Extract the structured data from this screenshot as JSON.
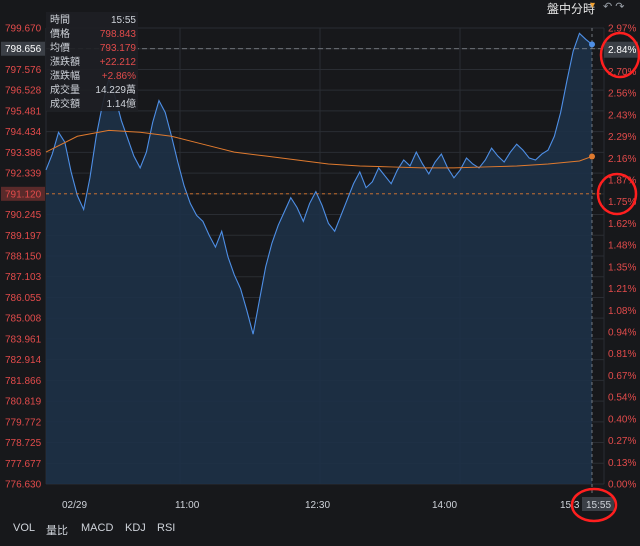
{
  "header": {
    "title": "盤中分時"
  },
  "info_box": {
    "rows": [
      {
        "label": "時間",
        "value": "15:55"
      },
      {
        "label": "價格",
        "value": "798.843"
      },
      {
        "label": "均價",
        "value": "793.179"
      },
      {
        "label": "漲跌額",
        "value": "+22.212"
      },
      {
        "label": "漲跌幅",
        "value": "+2.86%"
      },
      {
        "label": "成交量",
        "value": "14.229萬"
      },
      {
        "label": "成交額",
        "value": "1.14億"
      }
    ]
  },
  "bottom_tabs": [
    "VOL",
    "量比",
    "MACD",
    "KDJ",
    "RSI"
  ],
  "chart_data": {
    "type": "line",
    "y_ticks_left": [
      "799.670",
      "798.656",
      "797.576",
      "796.528",
      "795.481",
      "794.434",
      "793.386",
      "792.339",
      "791.120",
      "790.245",
      "789.197",
      "788.150",
      "787.103",
      "786.055",
      "785.008",
      "783.961",
      "782.914",
      "781.866",
      "780.819",
      "779.772",
      "778.725",
      "777.677",
      "776.630"
    ],
    "y_ticks_right": [
      "2.97%",
      "2.84%",
      "2.70%",
      "2.56%",
      "2.43%",
      "2.29%",
      "2.16%",
      "1.87%",
      "1.75%",
      "1.62%",
      "1.48%",
      "1.35%",
      "1.21%",
      "1.08%",
      "0.94%",
      "0.81%",
      "0.67%",
      "0.54%",
      "0.40%",
      "0.27%",
      "0.13%",
      "0.00%"
    ],
    "x_ticks": [
      "02/29",
      "11:00",
      "12:30",
      "14:00",
      "15:3",
      "15:55"
    ],
    "highlight": {
      "left_value": "798.656",
      "right_value": "2.84%",
      "base_left": "791.120",
      "base_right": "1.87%"
    },
    "ylim": [
      776.63,
      799.67
    ],
    "colors": {
      "price": "#4e8fe6",
      "avg": "#e07a2e",
      "fill": "#1d3147",
      "grid": "#2a2d33",
      "tick_red": "#e24b4b",
      "baseline": "#e07a2e"
    },
    "price_series": [
      [
        0,
        792.5
      ],
      [
        2,
        793.3
      ],
      [
        4,
        794.4
      ],
      [
        6,
        793.9
      ],
      [
        8,
        792.4
      ],
      [
        10,
        791.2
      ],
      [
        12,
        790.5
      ],
      [
        14,
        792.1
      ],
      [
        16,
        794.2
      ],
      [
        18,
        795.8
      ],
      [
        20,
        797.1
      ],
      [
        22,
        796.2
      ],
      [
        24,
        795.0
      ],
      [
        26,
        794.1
      ],
      [
        28,
        793.2
      ],
      [
        30,
        792.6
      ],
      [
        32,
        793.4
      ],
      [
        34,
        794.9
      ],
      [
        36,
        796.0
      ],
      [
        38,
        795.4
      ],
      [
        40,
        794.2
      ],
      [
        42,
        792.9
      ],
      [
        44,
        791.7
      ],
      [
        46,
        790.8
      ],
      [
        48,
        790.2
      ],
      [
        50,
        789.9
      ],
      [
        52,
        789.2
      ],
      [
        54,
        788.6
      ],
      [
        56,
        789.4
      ],
      [
        58,
        788.1
      ],
      [
        60,
        787.2
      ],
      [
        62,
        786.5
      ],
      [
        64,
        785.4
      ],
      [
        66,
        784.2
      ],
      [
        68,
        785.9
      ],
      [
        70,
        787.6
      ],
      [
        72,
        788.8
      ],
      [
        74,
        789.7
      ],
      [
        76,
        790.4
      ],
      [
        78,
        791.1
      ],
      [
        80,
        790.6
      ],
      [
        82,
        789.9
      ],
      [
        84,
        790.8
      ],
      [
        86,
        791.4
      ],
      [
        88,
        790.7
      ],
      [
        90,
        789.8
      ],
      [
        92,
        789.4
      ],
      [
        94,
        790.2
      ],
      [
        96,
        791.0
      ],
      [
        98,
        791.8
      ],
      [
        100,
        792.4
      ],
      [
        102,
        791.6
      ],
      [
        104,
        791.9
      ],
      [
        106,
        792.6
      ],
      [
        108,
        792.2
      ],
      [
        110,
        791.8
      ],
      [
        112,
        792.5
      ],
      [
        114,
        793.0
      ],
      [
        116,
        792.7
      ],
      [
        118,
        793.4
      ],
      [
        120,
        792.8
      ],
      [
        122,
        792.3
      ],
      [
        124,
        792.9
      ],
      [
        126,
        793.3
      ],
      [
        128,
        792.6
      ],
      [
        130,
        792.1
      ],
      [
        132,
        792.5
      ],
      [
        134,
        793.1
      ],
      [
        136,
        792.8
      ],
      [
        138,
        792.6
      ],
      [
        140,
        793.0
      ],
      [
        142,
        793.6
      ],
      [
        144,
        793.2
      ],
      [
        146,
        792.9
      ],
      [
        148,
        793.4
      ],
      [
        150,
        793.8
      ],
      [
        152,
        793.5
      ],
      [
        154,
        793.1
      ],
      [
        156,
        793.0
      ],
      [
        158,
        793.3
      ],
      [
        160,
        793.5
      ],
      [
        162,
        794.2
      ],
      [
        164,
        795.4
      ],
      [
        166,
        797.0
      ],
      [
        168,
        798.5
      ],
      [
        170,
        799.4
      ],
      [
        172,
        799.1
      ],
      [
        174,
        798.84
      ]
    ],
    "avg_series": [
      [
        0,
        793.4
      ],
      [
        10,
        794.2
      ],
      [
        20,
        794.5
      ],
      [
        30,
        794.4
      ],
      [
        40,
        794.2
      ],
      [
        50,
        793.8
      ],
      [
        60,
        793.4
      ],
      [
        70,
        793.2
      ],
      [
        80,
        793.0
      ],
      [
        90,
        792.8
      ],
      [
        100,
        792.7
      ],
      [
        110,
        792.65
      ],
      [
        120,
        792.6
      ],
      [
        130,
        792.6
      ],
      [
        140,
        792.65
      ],
      [
        150,
        792.7
      ],
      [
        160,
        792.8
      ],
      [
        170,
        792.95
      ],
      [
        174,
        793.18
      ]
    ],
    "current_price": 798.843,
    "current_avg": 793.179
  }
}
